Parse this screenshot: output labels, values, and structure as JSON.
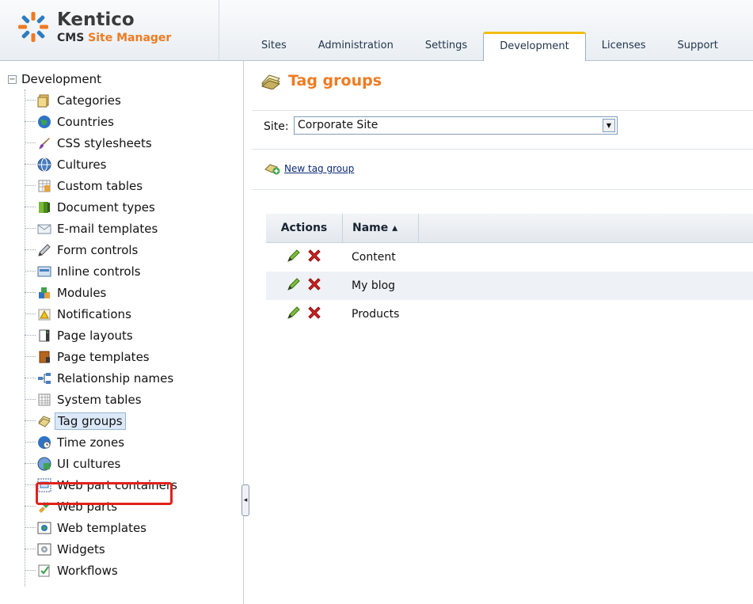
{
  "app": {
    "brand": "Kentico",
    "subtitle_prefix": "CMS ",
    "subtitle_accent": "Site Manager"
  },
  "tabs": [
    {
      "label": "Sites"
    },
    {
      "label": "Administration"
    },
    {
      "label": "Settings"
    },
    {
      "label": "Development",
      "active": true
    },
    {
      "label": "Licenses"
    },
    {
      "label": "Support"
    }
  ],
  "tree": {
    "root": {
      "label": "Development",
      "expander": "−"
    },
    "items": [
      {
        "label": "Categories",
        "icon": "categories-icon"
      },
      {
        "label": "Countries",
        "icon": "globe-icon"
      },
      {
        "label": "CSS stylesheets",
        "icon": "brush-icon"
      },
      {
        "label": "Cultures",
        "icon": "culture-globe-icon"
      },
      {
        "label": "Custom tables",
        "icon": "custom-table-icon"
      },
      {
        "label": "Document types",
        "icon": "document-types-icon"
      },
      {
        "label": "E-mail templates",
        "icon": "email-template-icon"
      },
      {
        "label": "Form controls",
        "icon": "form-controls-icon"
      },
      {
        "label": "Inline controls",
        "icon": "inline-controls-icon"
      },
      {
        "label": "Modules",
        "icon": "modules-icon"
      },
      {
        "label": "Notifications",
        "icon": "notifications-icon"
      },
      {
        "label": "Page layouts",
        "icon": "page-layouts-icon"
      },
      {
        "label": "Page templates",
        "icon": "page-templates-icon"
      },
      {
        "label": "Relationship names",
        "icon": "relationship-icon"
      },
      {
        "label": "System tables",
        "icon": "system-tables-icon"
      },
      {
        "label": "Tag groups",
        "icon": "tag-groups-icon",
        "selected": true
      },
      {
        "label": "Time zones",
        "icon": "time-zones-icon"
      },
      {
        "label": "UI cultures",
        "icon": "ui-cultures-icon"
      },
      {
        "label": "Web part containers",
        "icon": "web-part-containers-icon"
      },
      {
        "label": "Web parts",
        "icon": "web-parts-icon"
      },
      {
        "label": "Web templates",
        "icon": "web-templates-icon"
      },
      {
        "label": "Widgets",
        "icon": "widgets-icon"
      },
      {
        "label": "Workflows",
        "icon": "workflows-icon"
      }
    ]
  },
  "main": {
    "title": "Tag groups",
    "site_label": "Site:",
    "site_value": "Corporate Site",
    "new_link": "New tag group",
    "grid": {
      "headers": {
        "actions": "Actions",
        "name": "Name ▴"
      },
      "rows": [
        {
          "name": "Content"
        },
        {
          "name": "My blog"
        },
        {
          "name": "Products"
        }
      ]
    }
  },
  "colors": {
    "accent_orange": "#ef7b22",
    "active_tab_border": "#f1be12",
    "highlight_red": "#e0221b"
  }
}
